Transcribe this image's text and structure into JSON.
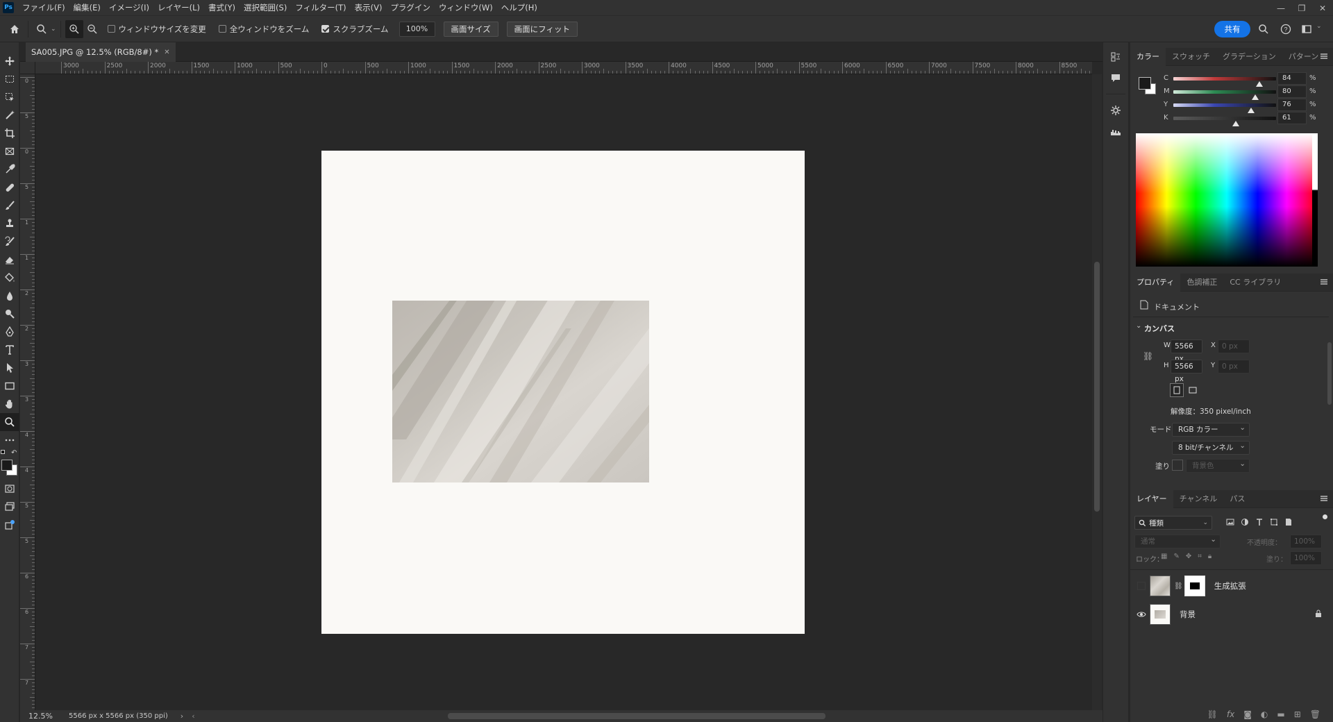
{
  "menubar": {
    "logo": "Ps",
    "items": [
      "ファイル(F)",
      "編集(E)",
      "イメージ(I)",
      "レイヤー(L)",
      "書式(Y)",
      "選択範囲(S)",
      "フィルター(T)",
      "表示(V)",
      "プラグイン",
      "ウィンドウ(W)",
      "ヘルプ(H)"
    ]
  },
  "options": {
    "resize_windows": "ウィンドウサイズを変更",
    "zoom_all": "全ウィンドウをズーム",
    "scrubby_zoom": "スクラブズーム",
    "zoom_value": "100%",
    "canvas_size_btn": "画面サイズ",
    "fit_screen_btn": "画面にフィット",
    "share": "共有"
  },
  "document": {
    "tab_title": "SA005.JPG @ 12.5% (RGB/8#) *",
    "zoom": "12.5%",
    "info": "5566 px x 5566 px (350 ppi)"
  },
  "ruler_top": [
    "3000",
    "2500",
    "2000",
    "1500",
    "1000",
    "500",
    "0",
    "500",
    "1000",
    "1500",
    "2000",
    "2500",
    "3000",
    "3500",
    "4000",
    "4500",
    "5000",
    "5500",
    "6000",
    "6500",
    "7000",
    "7500",
    "8000",
    "8500"
  ],
  "ruler_left": [
    "0",
    "5",
    "0",
    "5",
    "1",
    "1",
    "2",
    "2",
    "3",
    "3",
    "4",
    "4",
    "5",
    "5",
    "6",
    "6",
    "7",
    "7"
  ],
  "color_panel": {
    "tabs": [
      "カラー",
      "スウォッチ",
      "グラデーション",
      "パターン"
    ],
    "channels": [
      {
        "label": "C",
        "value": "84",
        "unit": "%",
        "fraction": 0.84
      },
      {
        "label": "M",
        "value": "80",
        "unit": "%",
        "fraction": 0.8
      },
      {
        "label": "Y",
        "value": "76",
        "unit": "%",
        "fraction": 0.76
      },
      {
        "label": "K",
        "value": "61",
        "unit": "%",
        "fraction": 0.61
      }
    ]
  },
  "properties": {
    "tabs": [
      "プロパティ",
      "色調補正",
      "CC ライブラリ"
    ],
    "doc_label": "ドキュメント",
    "canvas_header": "カンバス",
    "w_label": "W",
    "w_value": "5566 px",
    "h_label": "H",
    "h_value": "5566 px",
    "x_label": "X",
    "x_placeholder": "0 px",
    "y_label": "Y",
    "y_placeholder": "0 px",
    "resolution": "解像度：350 pixel/inch",
    "mode_label": "モード",
    "mode_value": "RGB カラー",
    "depth_value": "8 bit/チャンネル",
    "fill_label": "塗り",
    "fill_value": "背景色"
  },
  "layers": {
    "tabs": [
      "レイヤー",
      "チャンネル",
      "パス"
    ],
    "filter_value": "種類",
    "blend_mode": "通常",
    "opacity_label": "不透明度：",
    "opacity_value": "100%",
    "lock_label": "ロック：",
    "fill_label": "塗り：",
    "fill_value": "100%",
    "items": [
      {
        "name": "生成拡張",
        "visible": false
      },
      {
        "name": "背景",
        "visible": true
      }
    ]
  }
}
